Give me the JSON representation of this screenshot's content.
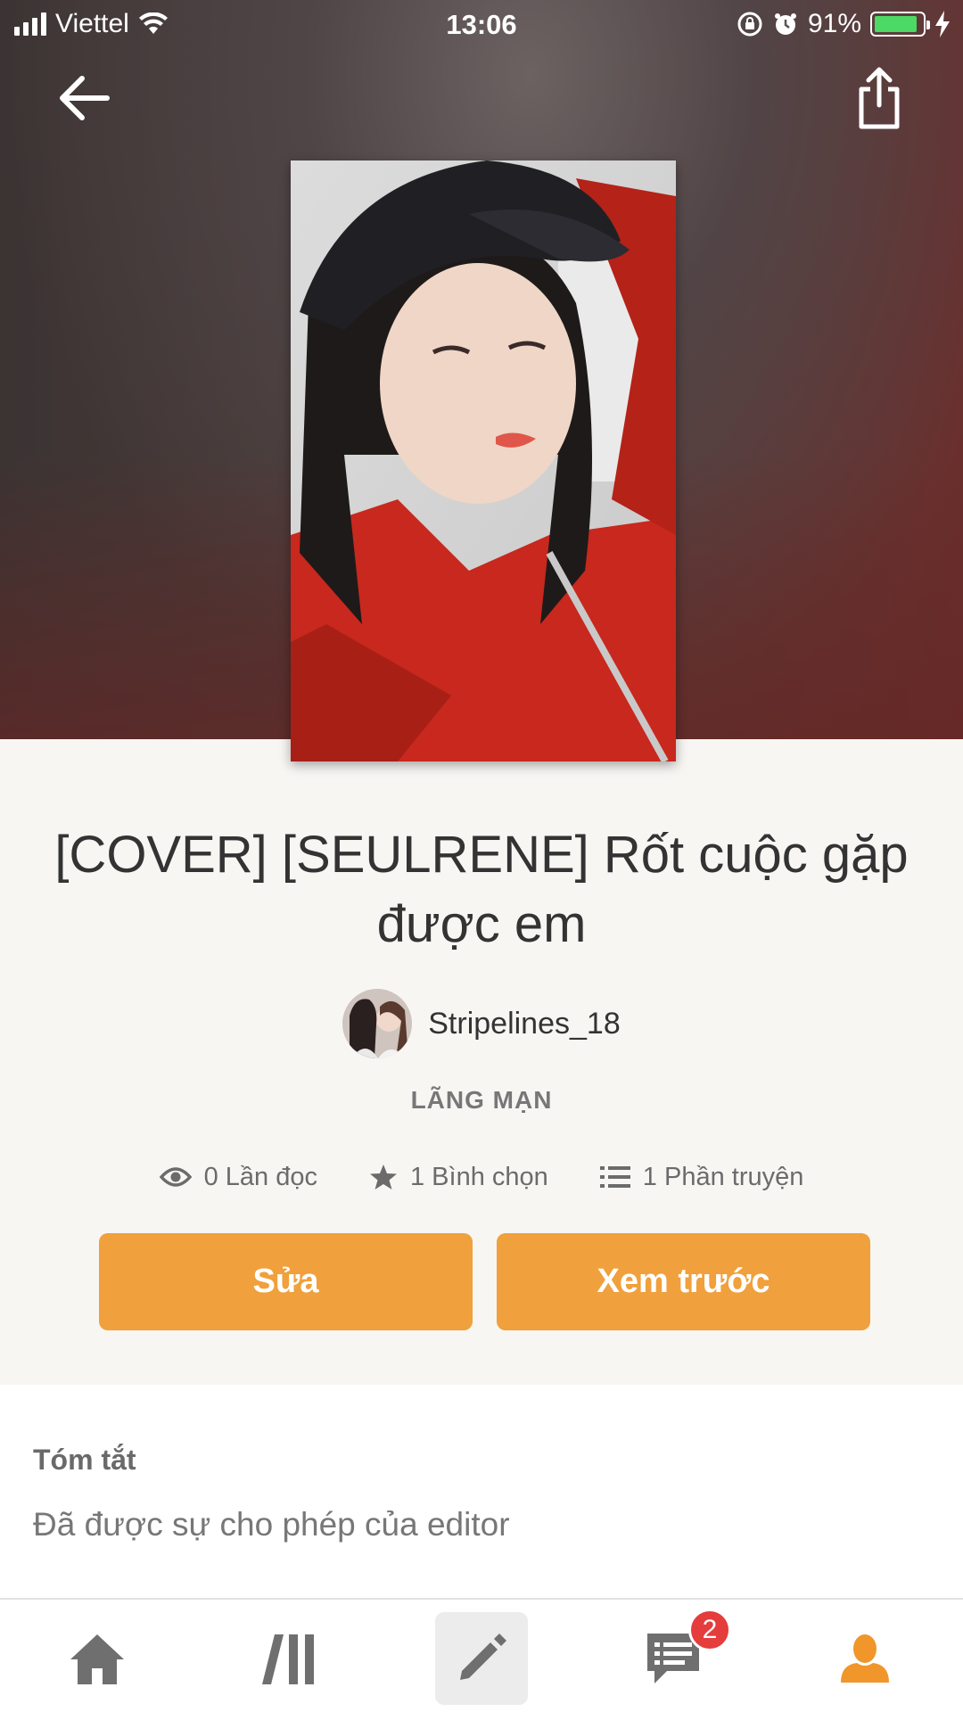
{
  "status_bar": {
    "carrier": "Viettel",
    "time": "13:06",
    "battery_percent": "91%",
    "battery_level": 0.91
  },
  "top_nav": {
    "back_icon": "arrow-left-icon",
    "share_icon": "share-icon"
  },
  "story": {
    "title": "[COVER] [SEULRENE] Rốt cuộc gặp được em",
    "author": "Stripelines_18",
    "genre": "LÃNG MẠN",
    "stats": {
      "reads": "0 Lần đọc",
      "votes": "1 Bình chọn",
      "parts": "1 Phần truyện"
    }
  },
  "actions": {
    "edit_label": "Sửa",
    "preview_label": "Xem trước"
  },
  "summary": {
    "heading": "Tóm tắt",
    "text": "Đã được sự cho phép của editor"
  },
  "tabbar": {
    "items": [
      "home-icon",
      "library-icon",
      "write-icon",
      "inbox-icon",
      "profile-icon"
    ],
    "inbox_badge": "2",
    "active_color": "#f0962a"
  },
  "colors": {
    "accent": "#f0a03c",
    "badge": "#e53c3c"
  }
}
